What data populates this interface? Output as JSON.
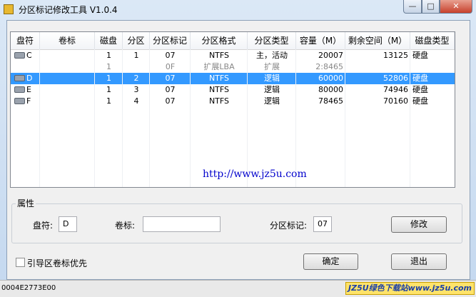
{
  "window": {
    "title": "分区标记修改工具 V1.0.4",
    "min_glyph": "—",
    "max_glyph": "□",
    "close_glyph": "✕"
  },
  "table": {
    "columns": [
      "盘符",
      "卷标",
      "磁盘",
      "分区",
      "分区标记",
      "分区格式",
      "分区类型",
      "容量（M）",
      "剩余空间（M）",
      "磁盘类型"
    ],
    "rows": [
      {
        "drive": "C",
        "label": "",
        "disk": "1",
        "part": "1",
        "flag": "07",
        "fs": "NTFS",
        "type": "主，活动",
        "size": "20007",
        "free": "13125",
        "dtype": "硬盘",
        "icon": "disk-icon",
        "selected": false,
        "ext": false
      },
      {
        "drive": "",
        "label": "",
        "disk": "1",
        "part": "",
        "flag": "0F",
        "fs": "扩展LBA",
        "type": "扩展",
        "size": "2:8465",
        "free": "",
        "dtype": "",
        "icon": "",
        "selected": false,
        "ext": true
      },
      {
        "drive": "D",
        "label": "",
        "disk": "1",
        "part": "2",
        "flag": "07",
        "fs": "NTFS",
        "type": "逻辑",
        "size": "60000",
        "free": "52806",
        "dtype": "硬盘",
        "icon": "disk-icon",
        "selected": true,
        "ext": false
      },
      {
        "drive": "E",
        "label": "",
        "disk": "1",
        "part": "3",
        "flag": "07",
        "fs": "NTFS",
        "type": "逻辑",
        "size": "80000",
        "free": "74946",
        "dtype": "硬盘",
        "icon": "disk-icon",
        "selected": false,
        "ext": false
      },
      {
        "drive": "F",
        "label": "",
        "disk": "1",
        "part": "4",
        "flag": "07",
        "fs": "NTFS",
        "type": "逻辑",
        "size": "78465",
        "free": "70160",
        "dtype": "硬盘",
        "icon": "disk-icon",
        "selected": false,
        "ext": false
      }
    ]
  },
  "url_text": "http://www.jz5u.com",
  "properties": {
    "group_title": "属性",
    "drive_label": "盘符:",
    "drive_value": "D",
    "volume_label": "卷标:",
    "volume_value": "",
    "flag_label": "分区标记:",
    "flag_value": "07",
    "modify_button": "修改"
  },
  "boot_checkbox_label": "引导区卷标优先",
  "boot_checkbox_checked": false,
  "ok_button": "确定",
  "exit_button": "退出",
  "status_text": "0004E2773E00",
  "watermark_text": "JZ5U绿色下载站www.jz5u.com"
}
